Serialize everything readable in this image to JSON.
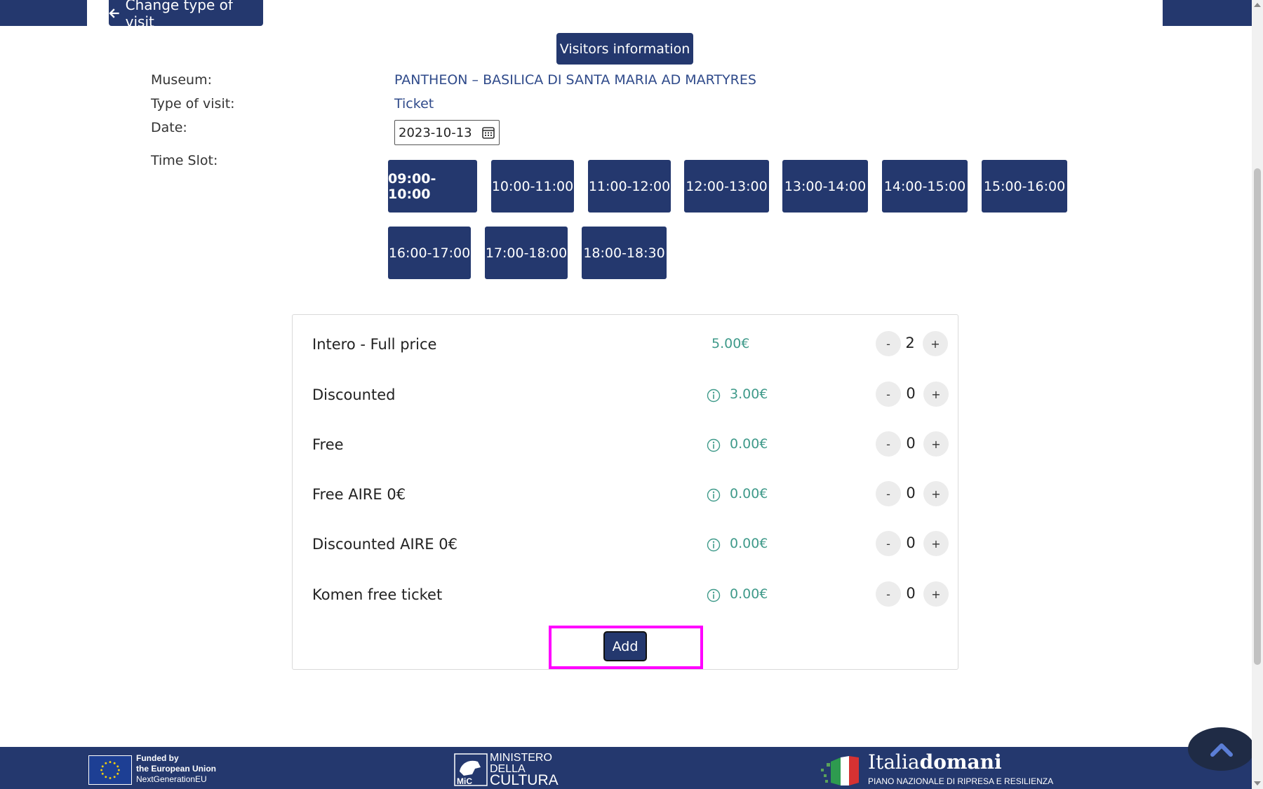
{
  "header": {
    "back_label": "Change type of visit",
    "visitors_info_label": "Visitors information"
  },
  "details": {
    "museum_label": "Museum:",
    "museum_value": "PANTHEON – BASILICA DI SANTA MARIA AD MARTYRES",
    "type_label": "Type of visit:",
    "type_value": "Ticket",
    "date_label": "Date:",
    "date_value": "2023-10-13",
    "timeslot_label": "Time Slot:"
  },
  "time_slots": [
    {
      "label": "09:00-10:00",
      "selected": true
    },
    {
      "label": "10:00-11:00",
      "selected": false
    },
    {
      "label": "11:00-12:00",
      "selected": false
    },
    {
      "label": "12:00-13:00",
      "selected": false
    },
    {
      "label": "13:00-14:00",
      "selected": false
    },
    {
      "label": "14:00-15:00",
      "selected": false
    },
    {
      "label": "15:00-16:00",
      "selected": false
    },
    {
      "label": "16:00-17:00",
      "selected": false
    },
    {
      "label": "17:00-18:00",
      "selected": false
    },
    {
      "label": "18:00-18:30",
      "selected": false
    }
  ],
  "tickets": [
    {
      "name": "Intero -  Full price",
      "price": "5.00€",
      "qty": "2",
      "has_info": false
    },
    {
      "name": "Discounted",
      "price": "3.00€",
      "qty": "0",
      "has_info": true
    },
    {
      "name": "Free",
      "price": "0.00€",
      "qty": "0",
      "has_info": true
    },
    {
      "name": "Free AIRE 0€",
      "price": "0.00€",
      "qty": "0",
      "has_info": true
    },
    {
      "name": "Discounted AIRE 0€",
      "price": "0.00€",
      "qty": "0",
      "has_info": true
    },
    {
      "name": "Komen free ticket",
      "price": "0.00€",
      "qty": "0",
      "has_info": true
    }
  ],
  "stepper": {
    "minus": "-",
    "plus": "+"
  },
  "add_label": "Add",
  "footer": {
    "eu_line1": "Funded by",
    "eu_line2": "the European Union",
    "eu_line3": "NextGenerationEU",
    "mic_line1": "MINISTERO",
    "mic_line2": "DELLA",
    "mic_line3": "CULTURA",
    "mic_badge": "MiC",
    "italia_prefix": "Italia",
    "italia_bold": "domani",
    "italia_sub": "PIANO NAZIONALE DI RIPRESA E RESILIENZA"
  },
  "colors": {
    "primary": "#24386e",
    "price": "#3f9a8a",
    "highlight": "#ff00ff"
  }
}
